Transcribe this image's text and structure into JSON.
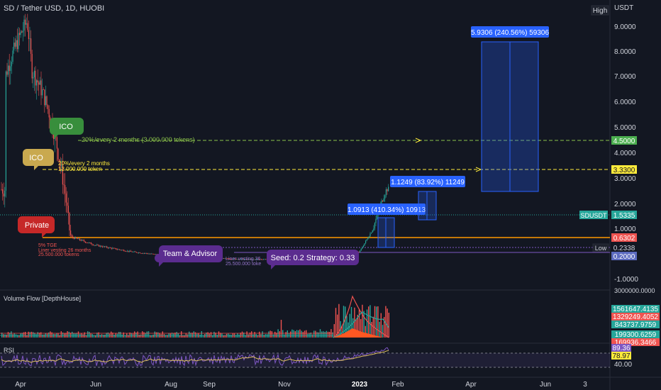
{
  "header": {
    "symbol_title": "SD / Tether USD, 1D, HUOBI",
    "high_badge": "High",
    "currency": "USDT"
  },
  "price_axis": {
    "ticks": [
      "9.0000",
      "8.0000",
      "7.0000",
      "6.0000",
      "5.0000",
      "4.0000",
      "3.0000",
      "2.0000",
      "1.0000",
      "-1.0000"
    ],
    "labels": {
      "lvl_450": "4.5000",
      "lvl_333": "3.3300",
      "last": "1.5335",
      "last_name": "SDUSDT",
      "lvl_063": "0.6302",
      "low_name": "Low",
      "low": "0.2338",
      "lvl_020": "0.2000"
    }
  },
  "time_axis": [
    "Apr",
    "Jun",
    "Aug",
    "Sep",
    "Nov",
    "2023",
    "Feb",
    "Apr",
    "Jun",
    "3"
  ],
  "annotations": {
    "ico_green": "ICO",
    "ico_green_note": "20%/every 2 months (3.000.000 tokens)",
    "ico_yellow": "ICO",
    "ico_yellow_note1": "20%/every 2 months",
    "ico_yellow_note2": "13.000.000 token",
    "private": "Private",
    "private_note1": "5% TGE",
    "private_note2": "Liner vesting 26 months",
    "private_note3": "25.500.000 tokens",
    "team": "Team & Advisor",
    "team_note1": "Liner vesting 36",
    "team_note2": "25.500.000 toke",
    "seed": "Seed: 0.2 Strategy: 0.33",
    "box1": "1.0913 (410.34%) 10913",
    "box2": "1.1249 (83.92%) 11249",
    "box3": "5.9306 (240.56%) 59306"
  },
  "volume_panel": {
    "title": "Volume Flow [DepthHouse]",
    "axis_top": "3000000.0000",
    "values": [
      "1561647.4135",
      "1329249.4052",
      "843737.9759",
      "199300.6259",
      "169936.3466"
    ],
    "colors": [
      "#26a69a",
      "#ef5350",
      "#26a69a",
      "#26a69a",
      "#ef5350"
    ]
  },
  "rsi_panel": {
    "title": "RSI",
    "values": [
      "89.36",
      "78.97",
      "40.00"
    ]
  },
  "colors": {
    "bg": "#131722",
    "up": "#26a69a",
    "down": "#ef5350",
    "green_line": "#8bc34a",
    "yellow_line": "#ffeb3b",
    "orange_line": "#ff9800",
    "blue_box": "#2962ff",
    "purple": "#5b2c8f"
  },
  "chart_data": {
    "type": "candlestick",
    "title": "SD / Tether USD, 1D, HUOBI",
    "x_labels": [
      "Apr",
      "Jun",
      "Aug",
      "Sep",
      "Nov",
      "2023",
      "Feb"
    ],
    "price_path": [
      {
        "t": "Apr",
        "v": 5.3
      },
      {
        "t": "early Apr",
        "v": 9.5
      },
      {
        "t": "mid Apr",
        "v": 5.6
      },
      {
        "t": "late Apr",
        "v": 4.2
      },
      {
        "t": "May",
        "v": 2.0
      },
      {
        "t": "mid May",
        "v": 0.8
      },
      {
        "t": "Jun",
        "v": 0.6
      },
      {
        "t": "Jul",
        "v": 0.45
      },
      {
        "t": "Aug",
        "v": 0.35
      },
      {
        "t": "Sep",
        "v": 0.3
      },
      {
        "t": "Oct",
        "v": 0.27
      },
      {
        "t": "Nov",
        "v": 0.28
      },
      {
        "t": "Dec",
        "v": 0.26
      },
      {
        "t": "2023",
        "v": 0.45
      },
      {
        "t": "mid Jan",
        "v": 1.53
      }
    ],
    "levels": [
      4.5,
      3.33,
      1.5335,
      0.6302,
      0.2338,
      0.2
    ],
    "ylim": [
      -1.5,
      9.5
    ]
  }
}
